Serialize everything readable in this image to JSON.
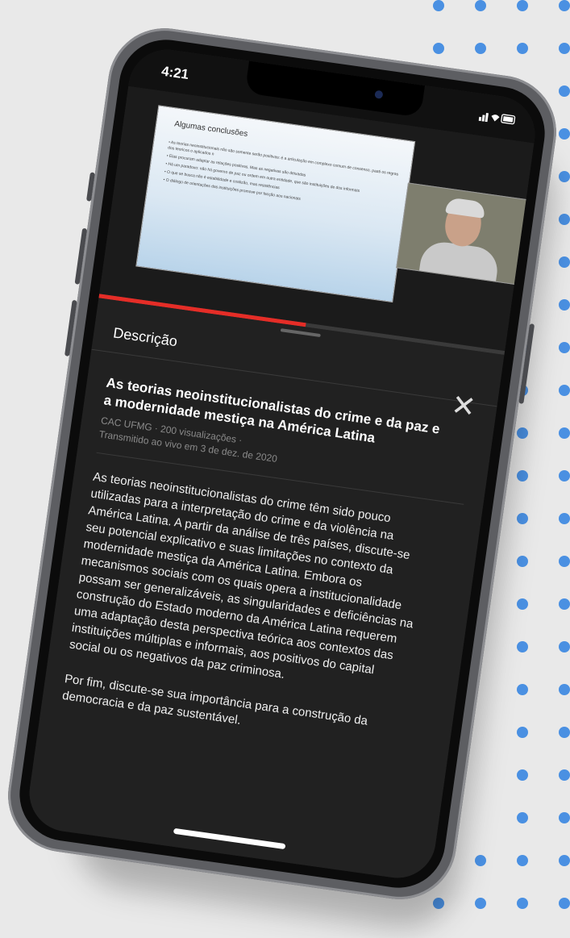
{
  "status_bar": {
    "time": "4:21"
  },
  "video": {
    "slide_title": "Algumas conclusões",
    "slide_bullets": [
      "• As teorias neoinstitucionais não são somente serão positivas: é a articulação em complexo comum de consenso, paati os regras dos teoricos o aplicados n",
      "• Elas procuram adaptar as relações positivas. Mas as negativas são deixadas",
      "• Há um paradoxo: não há governo de paz ou ordem em outra entidade, que são instituições de dos informais",
      "• O que se busca não é estabilidade e coalizão, mas resistências",
      "• O diálogo de orientações das instituições promove por facção aos nacionais"
    ],
    "progress": 0.51
  },
  "panel": {
    "heading": "Descrição",
    "close_symbol": "✕",
    "video_title": "As teorias neoinstitucionalistas do crime e da paz e a modernidade mestiça na América Latina",
    "channel_views": "CAC UFMG · 200 visualizações ·",
    "streamed": "Transmitido ao vivo em 3 de dez. de 2020",
    "description_p1": "As teorias neoinstitucionalistas do crime têm sido pouco utilizadas para a interpretação do crime e da violência na América Latina. A partir da análise de três países, discute-se seu potencial explicativo e suas limitações no contexto da modernidade mestiça da América Latina. Embora os mecanismos sociais com os quais opera a institucionalidade possam ser generalizáveis, as singularidades e deficiências na construção do Estado moderno da América Latina requerem uma adaptação desta perspectiva teórica aos contextos das instituições múltiplas e informais, aos positivos do capital social ou os negativos da paz criminosa.",
    "description_p2": "Por fim, discute-se sua importância para a construção da democracia e da paz sustentável."
  },
  "colors": {
    "accent": "#e52d27",
    "dots": "#4a90e2",
    "panel": "#212121"
  }
}
